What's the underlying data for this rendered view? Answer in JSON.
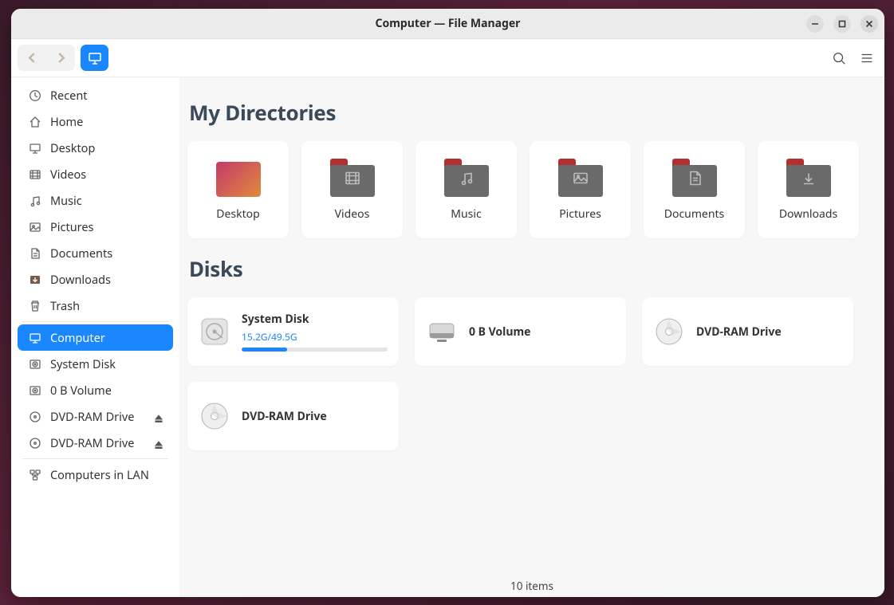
{
  "window": {
    "title": "Computer — File Manager"
  },
  "sidebar": {
    "items": [
      {
        "label": "Recent",
        "icon": "clock",
        "active": false
      },
      {
        "label": "Home",
        "icon": "home",
        "active": false
      },
      {
        "label": "Desktop",
        "icon": "desktop",
        "active": false
      },
      {
        "label": "Videos",
        "icon": "video",
        "active": false
      },
      {
        "label": "Music",
        "icon": "music",
        "active": false
      },
      {
        "label": "Pictures",
        "icon": "pictures",
        "active": false
      },
      {
        "label": "Documents",
        "icon": "document",
        "active": false
      },
      {
        "label": "Downloads",
        "icon": "download",
        "active": false
      },
      {
        "label": "Trash",
        "icon": "trash",
        "active": false
      },
      {
        "label": "Computer",
        "icon": "monitor",
        "active": true
      },
      {
        "label": "System Disk",
        "icon": "disk",
        "active": false
      },
      {
        "label": "0 B Volume",
        "icon": "disk",
        "active": false
      },
      {
        "label": "DVD-RAM Drive",
        "icon": "optical",
        "active": false,
        "eject": true
      },
      {
        "label": "DVD-RAM Drive",
        "icon": "optical",
        "active": false,
        "eject": true
      },
      {
        "label": "Computers in LAN",
        "icon": "lan",
        "active": false
      }
    ],
    "sep_before": [
      9,
      14
    ]
  },
  "sections": {
    "dirs_title": "My Directories",
    "disks_title": "Disks"
  },
  "directories": [
    {
      "label": "Desktop",
      "kind": "desktop"
    },
    {
      "label": "Videos",
      "kind": "video"
    },
    {
      "label": "Music",
      "kind": "music"
    },
    {
      "label": "Pictures",
      "kind": "pictures"
    },
    {
      "label": "Documents",
      "kind": "document"
    },
    {
      "label": "Downloads",
      "kind": "download"
    }
  ],
  "disks": [
    {
      "name": "System Disk",
      "icon": "hdd",
      "used_label": "15.2G/49.5G",
      "used_pct": 31
    },
    {
      "name": "0 B Volume",
      "icon": "ext",
      "used_label": null
    },
    {
      "name": "DVD-RAM Drive",
      "icon": "optical",
      "used_label": null
    },
    {
      "name": "DVD-RAM Drive",
      "icon": "optical",
      "used_label": null
    }
  ],
  "status": {
    "text": "10 items"
  },
  "colors": {
    "accent": "#1a87ff",
    "folder_tab": "#b23030",
    "folder_body": "#6a6a6a",
    "desktop_grad_a": "#c43a6a",
    "desktop_grad_b": "#e08a3c"
  }
}
